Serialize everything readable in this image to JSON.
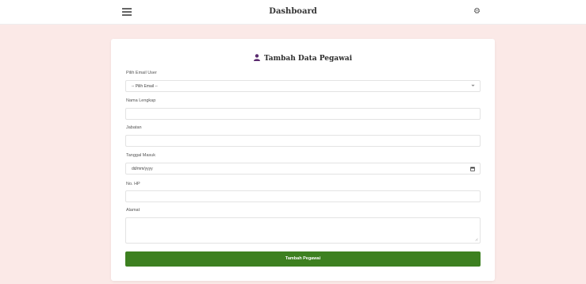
{
  "header": {
    "title": "Dashboard",
    "menu_icon": "hamburger-menu-icon",
    "settings_icon": "gear-icon"
  },
  "form": {
    "title": "Tambah Data Pegawai",
    "title_icon": "user-icon",
    "email": {
      "label": "Pilih Email User",
      "selected": "-- Pilih Email --"
    },
    "nama": {
      "label": "Nama Lengkap",
      "value": ""
    },
    "jabatan": {
      "label": "Jabatan",
      "value": ""
    },
    "tanggal": {
      "label": "Tanggal Masuk",
      "placeholder": "dd/mm/yyyy"
    },
    "hp": {
      "label": "No. HP",
      "value": ""
    },
    "alamat": {
      "label": "Alamat",
      "value": ""
    },
    "submit_label": "Tambah Pegawai"
  },
  "colors": {
    "page_background": "#fbe9e7",
    "submit_button": "#3d8020",
    "title_icon": "#5a2a6e"
  }
}
